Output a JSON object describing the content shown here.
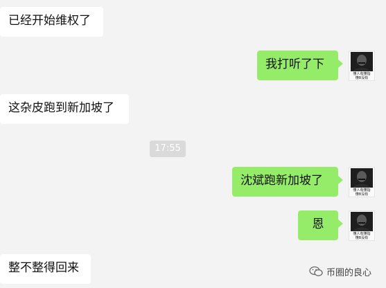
{
  "chat": {
    "messages": [
      {
        "side": "in",
        "text": "已经开始维权了"
      },
      {
        "side": "out",
        "text": "我打听了下"
      },
      {
        "side": "in",
        "text": "这杂皮跑到新加坡了"
      },
      {
        "side": "out",
        "text": "沈斌跑新加坡了"
      },
      {
        "side": "out",
        "text": "恩"
      },
      {
        "side": "in",
        "text": "整不整得回来"
      }
    ],
    "timestamp": "17:55",
    "avatar_caption": "懂人有懂指\n懂B没有"
  },
  "watermark": {
    "text": "币圈的良心",
    "icon": "wechat-icon"
  },
  "colors": {
    "background": "#f3f3f3",
    "incoming": "#ffffff",
    "outgoing": "#95ec69"
  }
}
